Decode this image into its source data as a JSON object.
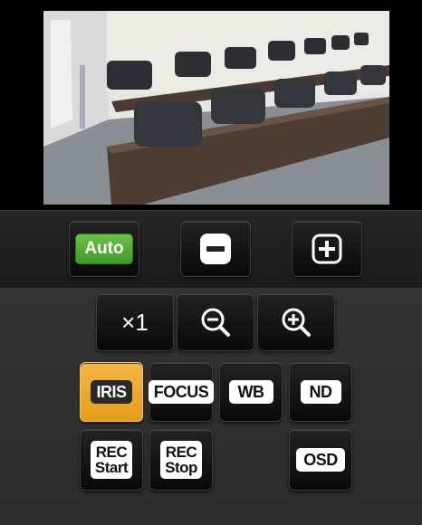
{
  "exposure": {
    "auto_label": "Auto",
    "minus_icon": "minus-square-icon",
    "plus_icon": "plus-square-icon"
  },
  "zoom": {
    "reset_label": "×1",
    "zoom_out_icon": "zoom-out-icon",
    "zoom_in_icon": "zoom-in-icon"
  },
  "functions": {
    "iris": "IRIS",
    "focus": "FOCUS",
    "wb": "WB",
    "nd": "ND",
    "rec_start_line1": "REC",
    "rec_start_line2": "Start",
    "rec_stop_line1": "REC",
    "rec_stop_line2": "Stop",
    "osd": "OSD",
    "active": "iris"
  },
  "colors": {
    "active": "#f0ad30",
    "auto": "#55ad36"
  }
}
